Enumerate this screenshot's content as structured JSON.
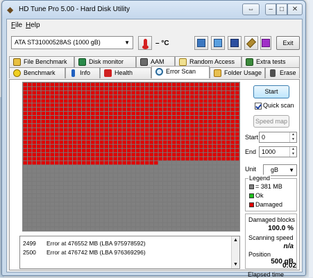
{
  "window": {
    "title": "HD Tune Pro 5.00 - Hard Disk Utility"
  },
  "menu": {
    "file": "File",
    "help": "Help"
  },
  "toolbar": {
    "drive": "ATA   ST31000528AS   (1000 gB)",
    "temperature": "– °C",
    "exit_label": "Exit"
  },
  "tabs": {
    "row1": [
      "File Benchmark",
      "Disk monitor",
      "AAM",
      "Random Access",
      "Extra tests"
    ],
    "row2": [
      "Benchmark",
      "Info",
      "Health",
      "Error Scan",
      "Folder Usage",
      "Erase"
    ],
    "active": "Error Scan"
  },
  "scan_map": {
    "columns": 48,
    "rows": 36,
    "damaged_blocks": 942,
    "damaged_color": "#e00000",
    "ok_color": "#808080"
  },
  "log": [
    {
      "id": "2499",
      "message": "Error at 476552 MB (LBA 975978592)"
    },
    {
      "id": "2500",
      "message": "Error at 476742 MB (LBA 976369296)"
    }
  ],
  "controls": {
    "start_label": "Start",
    "quick_scan_label": "Quick scan",
    "quick_scan_checked": true,
    "speed_map_label": "Speed map",
    "start_field_label": "Start",
    "start_value": "0",
    "end_field_label": "End",
    "end_value": "1000",
    "unit_label": "Unit",
    "unit_value": "gB"
  },
  "legend": {
    "title": "Legend",
    "block_size": "= 381 MB",
    "ok": "Ok",
    "damaged": "Damaged"
  },
  "stats": {
    "damaged_blocks_label": "Damaged blocks",
    "damaged_blocks_value": "100.0 %",
    "scanning_speed_label": "Scanning speed",
    "scanning_speed_value": "n/a",
    "position_label": "Position",
    "position_value": "500 gB",
    "elapsed_label": "Elapsed time",
    "elapsed_value": "0:02"
  }
}
